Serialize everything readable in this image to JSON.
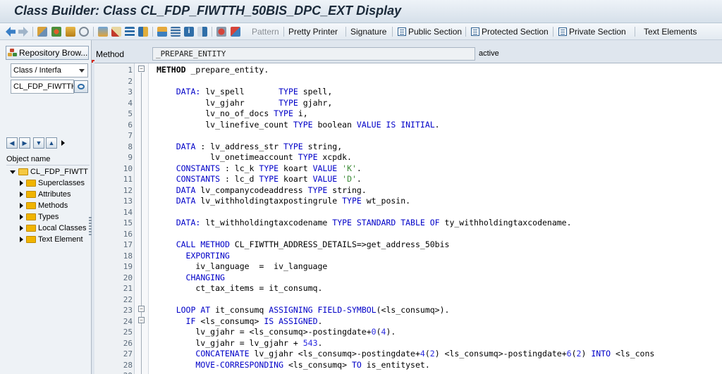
{
  "title": "Class Builder: Class CL_FDP_FIWTTH_50BIS_DPC_EXT Display",
  "toolbar": {
    "pattern": "Pattern",
    "pretty_printer": "Pretty Printer",
    "signature": "Signature",
    "public_section": "Public Section",
    "protected_section": "Protected Section",
    "private_section": "Private Section",
    "text_elements": "Text Elements"
  },
  "left": {
    "repo_browser": "Repository Brow...",
    "obj_type": "Class / Interfa",
    "obj_name": "CL_FDP_FIWTTH",
    "object_name_header": "Object name",
    "root": "CL_FDP_FIWTT",
    "items": [
      "Superclasses",
      "Attributes",
      "Methods",
      "Types",
      "Local Classes",
      "Text Element"
    ]
  },
  "editor_header": {
    "method_label": "Method",
    "method_name": "_PREPARE_ENTITY",
    "status": "active"
  },
  "colors": {
    "keyword": "#0000c8",
    "string": "#3d8b37",
    "number": "#2a2ae0"
  },
  "code_lines": [
    [
      {
        "t": "METHOD",
        "k": "b"
      },
      {
        "t": " _prepare_entity."
      }
    ],
    [],
    [
      {
        "t": "    "
      },
      {
        "t": "DATA:",
        "k": "kw"
      },
      {
        "t": " lv_spell       "
      },
      {
        "t": "TYPE",
        "k": "kw"
      },
      {
        "t": " spell,"
      }
    ],
    [
      {
        "t": "          lv_gjahr       "
      },
      {
        "t": "TYPE",
        "k": "kw"
      },
      {
        "t": " gjahr,"
      }
    ],
    [
      {
        "t": "          lv_no_of_docs "
      },
      {
        "t": "TYPE",
        "k": "kw"
      },
      {
        "t": " i,"
      }
    ],
    [
      {
        "t": "          lv_linefive_count "
      },
      {
        "t": "TYPE",
        "k": "kw"
      },
      {
        "t": " boolean "
      },
      {
        "t": "VALUE IS INITIAL",
        "k": "kw"
      },
      {
        "t": "."
      }
    ],
    [],
    [
      {
        "t": "    "
      },
      {
        "t": "DATA",
        "k": "kw"
      },
      {
        "t": " : lv_address_str "
      },
      {
        "t": "TYPE",
        "k": "kw"
      },
      {
        "t": " string,"
      }
    ],
    [
      {
        "t": "           lv_onetimeaccount "
      },
      {
        "t": "TYPE",
        "k": "kw"
      },
      {
        "t": " xcpdk."
      }
    ],
    [
      {
        "t": "    "
      },
      {
        "t": "CONSTANTS",
        "k": "kw"
      },
      {
        "t": " : lc_k "
      },
      {
        "t": "TYPE",
        "k": "kw"
      },
      {
        "t": " koart "
      },
      {
        "t": "VALUE",
        "k": "kw"
      },
      {
        "t": " "
      },
      {
        "t": "'K'",
        "k": "str"
      },
      {
        "t": "."
      }
    ],
    [
      {
        "t": "    "
      },
      {
        "t": "CONSTANTS",
        "k": "kw"
      },
      {
        "t": " : lc_d "
      },
      {
        "t": "TYPE",
        "k": "kw"
      },
      {
        "t": " koart "
      },
      {
        "t": "VALUE",
        "k": "kw"
      },
      {
        "t": " "
      },
      {
        "t": "'D'",
        "k": "str"
      },
      {
        "t": "."
      }
    ],
    [
      {
        "t": "    "
      },
      {
        "t": "DATA",
        "k": "kw"
      },
      {
        "t": " lv_companycodeaddress "
      },
      {
        "t": "TYPE",
        "k": "kw"
      },
      {
        "t": " string."
      }
    ],
    [
      {
        "t": "    "
      },
      {
        "t": "DATA",
        "k": "kw"
      },
      {
        "t": " lv_withholdingtaxpostingrule "
      },
      {
        "t": "TYPE",
        "k": "kw"
      },
      {
        "t": " wt_posin."
      }
    ],
    [],
    [
      {
        "t": "    "
      },
      {
        "t": "DATA:",
        "k": "kw"
      },
      {
        "t": " lt_withholdingtaxcodename "
      },
      {
        "t": "TYPE STANDARD TABLE OF",
        "k": "kw"
      },
      {
        "t": " ty_withholdingtaxcodename."
      }
    ],
    [],
    [
      {
        "t": "    "
      },
      {
        "t": "CALL METHOD",
        "k": "kw"
      },
      {
        "t": " CL_FIWTTH_ADDRESS_DETAILS=>get_address_50bis"
      }
    ],
    [
      {
        "t": "      "
      },
      {
        "t": "EXPORTING",
        "k": "kw"
      }
    ],
    [
      {
        "t": "        iv_language  =  iv_language"
      }
    ],
    [
      {
        "t": "      "
      },
      {
        "t": "CHANGING",
        "k": "kw"
      }
    ],
    [
      {
        "t": "        ct_tax_items = it_consumq."
      }
    ],
    [],
    [
      {
        "t": "    "
      },
      {
        "t": "LOOP AT",
        "k": "kw"
      },
      {
        "t": " it_consumq "
      },
      {
        "t": "ASSIGNING FIELD-SYMBOL",
        "k": "kw"
      },
      {
        "t": "(<ls_consumq>)."
      }
    ],
    [
      {
        "t": "      "
      },
      {
        "t": "IF",
        "k": "kw"
      },
      {
        "t": " <ls_consumq> "
      },
      {
        "t": "IS ASSIGNED",
        "k": "kw"
      },
      {
        "t": "."
      }
    ],
    [
      {
        "t": "        lv_gjahr = <ls_consumq>-postingdate+"
      },
      {
        "t": "0",
        "k": "num"
      },
      {
        "t": "("
      },
      {
        "t": "4",
        "k": "num"
      },
      {
        "t": ")."
      }
    ],
    [
      {
        "t": "        lv_gjahr = lv_gjahr + "
      },
      {
        "t": "543",
        "k": "num"
      },
      {
        "t": "."
      }
    ],
    [
      {
        "t": "        "
      },
      {
        "t": "CONCATENATE",
        "k": "kw"
      },
      {
        "t": " lv_gjahr <ls_consumq>-postingdate+"
      },
      {
        "t": "4",
        "k": "num"
      },
      {
        "t": "("
      },
      {
        "t": "2",
        "k": "num"
      },
      {
        "t": ") <ls_consumq>-postingdate+"
      },
      {
        "t": "6",
        "k": "num"
      },
      {
        "t": "("
      },
      {
        "t": "2",
        "k": "num"
      },
      {
        "t": ") "
      },
      {
        "t": "INTO",
        "k": "kw"
      },
      {
        "t": " <ls_cons"
      }
    ],
    [
      {
        "t": "        "
      },
      {
        "t": "MOVE-CORRESPONDING",
        "k": "kw"
      },
      {
        "t": " <ls_consumq> "
      },
      {
        "t": "TO",
        "k": "kw"
      },
      {
        "t": " is_entityset."
      }
    ],
    []
  ]
}
